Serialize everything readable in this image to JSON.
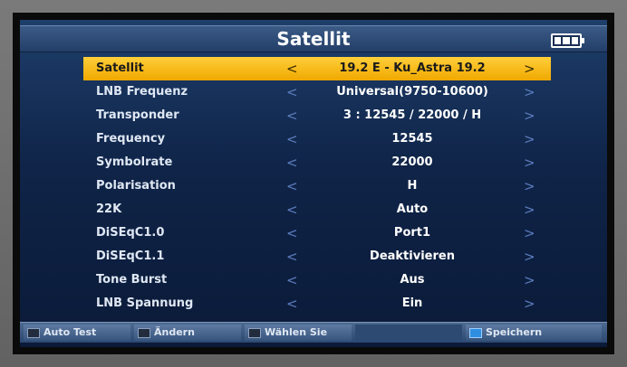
{
  "header": {
    "title": "Satellit",
    "battery_icon": "battery-icon"
  },
  "menu": {
    "items": [
      {
        "label": "Satellit",
        "value": "19.2 E - Ku_Astra 19.2",
        "selected": true
      },
      {
        "label": "LNB Frequenz",
        "value": "Universal(9750-10600)"
      },
      {
        "label": "Transponder",
        "value": "3 : 12545 / 22000 / H"
      },
      {
        "label": "Frequency",
        "value": "12545"
      },
      {
        "label": "Symbolrate",
        "value": "22000"
      },
      {
        "label": "Polarisation",
        "value": "H"
      },
      {
        "label": "22K",
        "value": "Auto"
      },
      {
        "label": "DiSEqC1.0",
        "value": "Port1"
      },
      {
        "label": "DiSEqC1.1",
        "value": "Deaktivieren"
      },
      {
        "label": "Tone Burst",
        "value": "Aus"
      },
      {
        "label": "LNB Spannung",
        "value": "Ein"
      }
    ],
    "arrow_left": "<",
    "arrow_right": ">"
  },
  "footer": {
    "auto_test": "Auto Test",
    "andern": "Ändern",
    "wahlen": "Wählen Sie",
    "speichern": "Speichern"
  },
  "colors": {
    "selected": "#f0a800",
    "screen_bg": "#0f2448",
    "header_bg": "#233f68",
    "save_key": "#2f8ee0"
  }
}
